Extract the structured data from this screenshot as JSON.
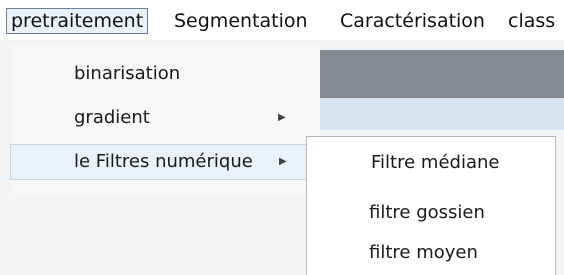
{
  "menubar": {
    "items": [
      {
        "label": "pretraitement"
      },
      {
        "label": "Segmentation"
      },
      {
        "label": "Caractérisation"
      },
      {
        "label": "class"
      }
    ]
  },
  "dropdown": {
    "items": [
      {
        "label": "binarisation",
        "has_submenu": false
      },
      {
        "label": "gradient",
        "has_submenu": true,
        "arrow_icon": "chevron-right-icon"
      },
      {
        "label": "le Filtres numérique",
        "has_submenu": true,
        "arrow_icon": "chevron-right-icon"
      }
    ]
  },
  "submenu": {
    "items": [
      {
        "label": "Filtre médiane"
      },
      {
        "label": "filtre gossien"
      },
      {
        "label": "filtre moyen"
      }
    ]
  }
}
